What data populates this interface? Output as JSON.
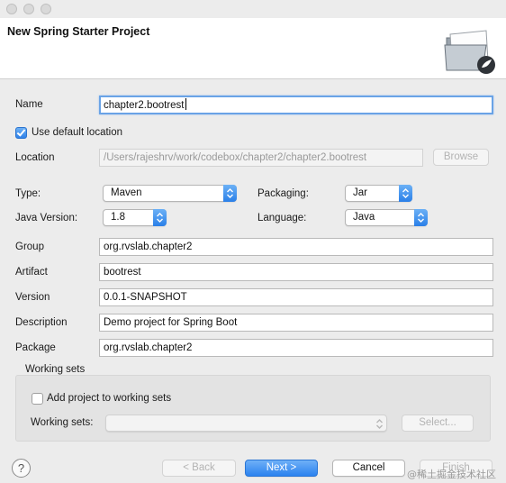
{
  "dialog": {
    "title": "New Spring Starter Project"
  },
  "form": {
    "name_label": "Name",
    "name_value": "chapter2.bootrest",
    "use_default_location_label": "Use default location",
    "use_default_location_checked": true,
    "location_label": "Location",
    "location_value": "/Users/rajeshrv/work/codebox/chapter2/chapter2.bootrest",
    "browse_label": "Browse",
    "type_label": "Type:",
    "type_value": "Maven",
    "packaging_label": "Packaging:",
    "packaging_value": "Jar",
    "java_version_label": "Java Version:",
    "java_version_value": "1.8",
    "language_label": "Language:",
    "language_value": "Java",
    "group_label": "Group",
    "group_value": "org.rvslab.chapter2",
    "artifact_label": "Artifact",
    "artifact_value": "bootrest",
    "version_label": "Version",
    "version_value": "0.0.1-SNAPSHOT",
    "description_label": "Description",
    "description_value": "Demo project for Spring Boot",
    "package_label": "Package",
    "package_value": "org.rvslab.chapter2"
  },
  "working_sets": {
    "group_label": "Working sets",
    "add_label": "Add project to working sets",
    "add_checked": false,
    "sets_label": "Working sets:",
    "sets_value": "",
    "select_label": "Select..."
  },
  "footer": {
    "help_glyph": "?",
    "back_label": "< Back",
    "next_label": "Next >",
    "cancel_label": "Cancel",
    "finish_label": "Finish",
    "watermark": "@稀土掘金技术社区"
  },
  "colors": {
    "accent": "#2b82ef",
    "window_bg": "#ececec",
    "banner_bg": "#ffffff",
    "focus_ring": "#6aa3e6"
  },
  "icons": {
    "close": "traffic-light-close",
    "minimize": "traffic-light-minimize",
    "zoom": "traffic-light-zoom",
    "banner": "spring-folder-wizard-icon",
    "help": "help-icon",
    "dropdown": "chevron-updown-icon"
  }
}
